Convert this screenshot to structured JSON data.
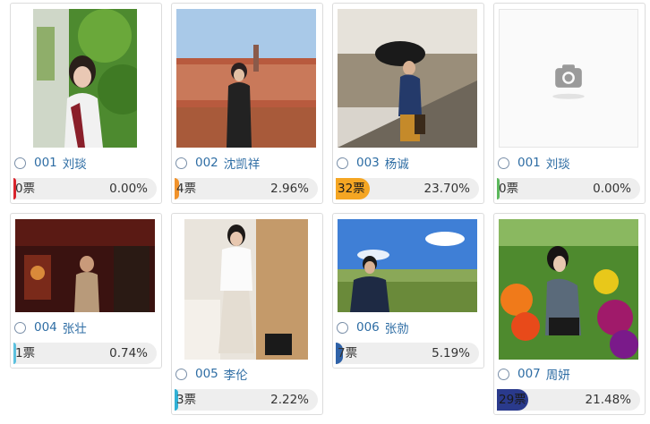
{
  "candidates": [
    {
      "num": "001",
      "name": "刘琰",
      "votes": "0票",
      "percent": "0.00%",
      "share": 0.0,
      "color": "#d9232b",
      "photo": "garden-portrait"
    },
    {
      "num": "002",
      "name": "沈凯祥",
      "votes": "4票",
      "percent": "2.96%",
      "share": 0.0296,
      "color": "#f0922b",
      "photo": "city-view-portrait"
    },
    {
      "num": "003",
      "name": "杨诚",
      "votes": "32票",
      "percent": "23.70%",
      "share": 0.237,
      "color": "#f5a623",
      "photo": "umbrella-stairs-portrait"
    },
    {
      "num": "001",
      "name": "刘琰",
      "votes": "0票",
      "percent": "0.00%",
      "share": 0.0,
      "color": "#5cb85c",
      "photo": "camera-placeholder"
    },
    {
      "num": "004",
      "name": "张壮",
      "votes": "1票",
      "percent": "0.74%",
      "share": 0.0074,
      "color": "#5bc0de",
      "photo": "stage-performance"
    },
    {
      "num": "005",
      "name": "李伦",
      "votes": "3票",
      "percent": "2.22%",
      "share": 0.0222,
      "color": "#31b0d5",
      "photo": "room-portrait"
    },
    {
      "num": "006",
      "name": "张勍",
      "votes": "7票",
      "percent": "5.19%",
      "share": 0.0519,
      "color": "#2f62a8",
      "photo": "field-sky-portrait"
    },
    {
      "num": "007",
      "name": "周妍",
      "votes": "29票",
      "percent": "21.48%",
      "share": 0.2148,
      "color": "#2a3a8c",
      "photo": "tulip-garden-portrait"
    }
  ]
}
